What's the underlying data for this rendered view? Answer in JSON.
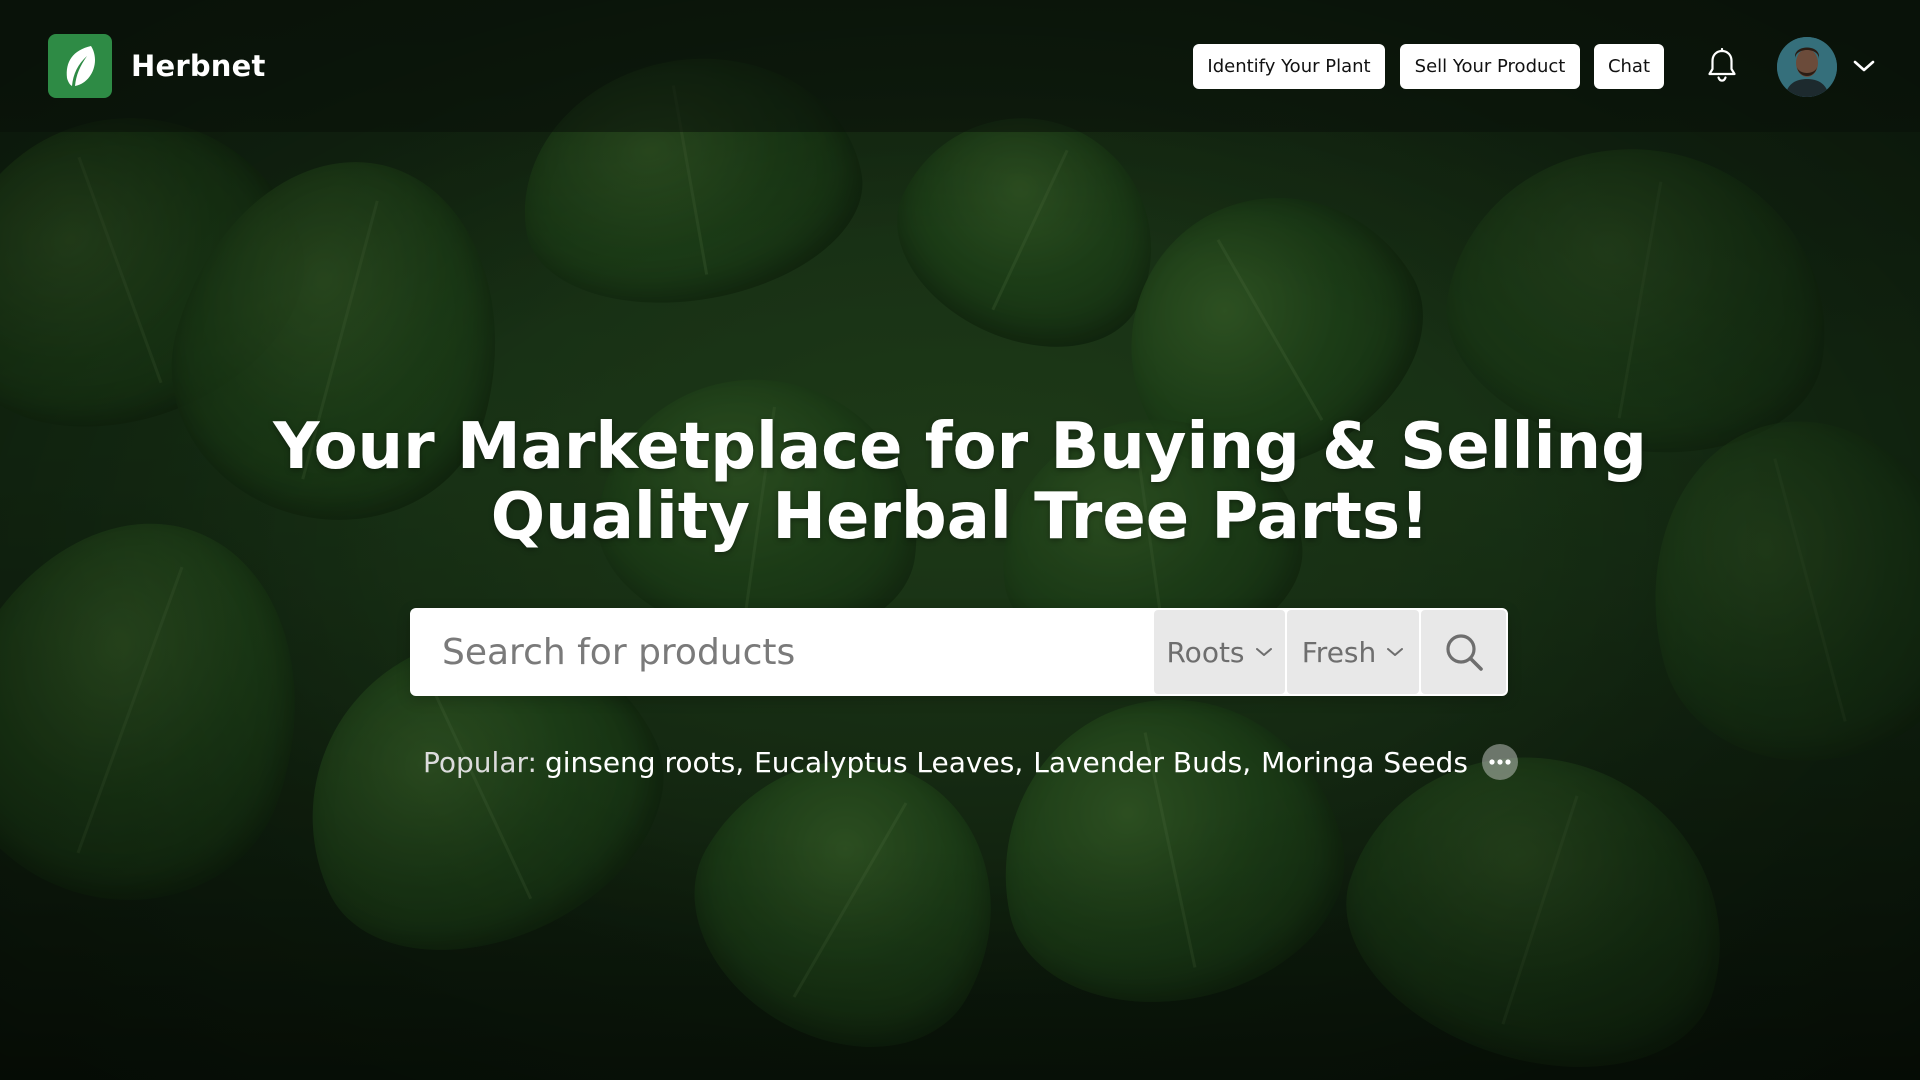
{
  "app": {
    "brand_name": "Herbnet",
    "accent_color": "#2e8b45"
  },
  "nav": {
    "buttons": [
      {
        "label": "Identify Your Plant"
      },
      {
        "label": "Sell Your Product"
      },
      {
        "label": "Chat"
      }
    ],
    "icons": [
      "leaf-logo-icon",
      "bell-icon",
      "chevron-down-icon"
    ]
  },
  "hero": {
    "headline_line1": "Your Marketplace for Buying & Selling",
    "headline_line2": "Quality Herbal Tree Parts!",
    "background": "basil-leaves-photo"
  },
  "search": {
    "placeholder": "Search for products",
    "value": "",
    "filters": [
      {
        "value": "Roots"
      },
      {
        "value": "Fresh"
      }
    ],
    "search_icon": "search-icon"
  },
  "popular": {
    "label": "Popular:",
    "items": [
      "ginseng roots",
      "Eucalyptus Leaves",
      "Lavender Buds",
      "Moringa Seeds"
    ],
    "separator": ",",
    "more_icon": "more-horizontal-icon"
  }
}
